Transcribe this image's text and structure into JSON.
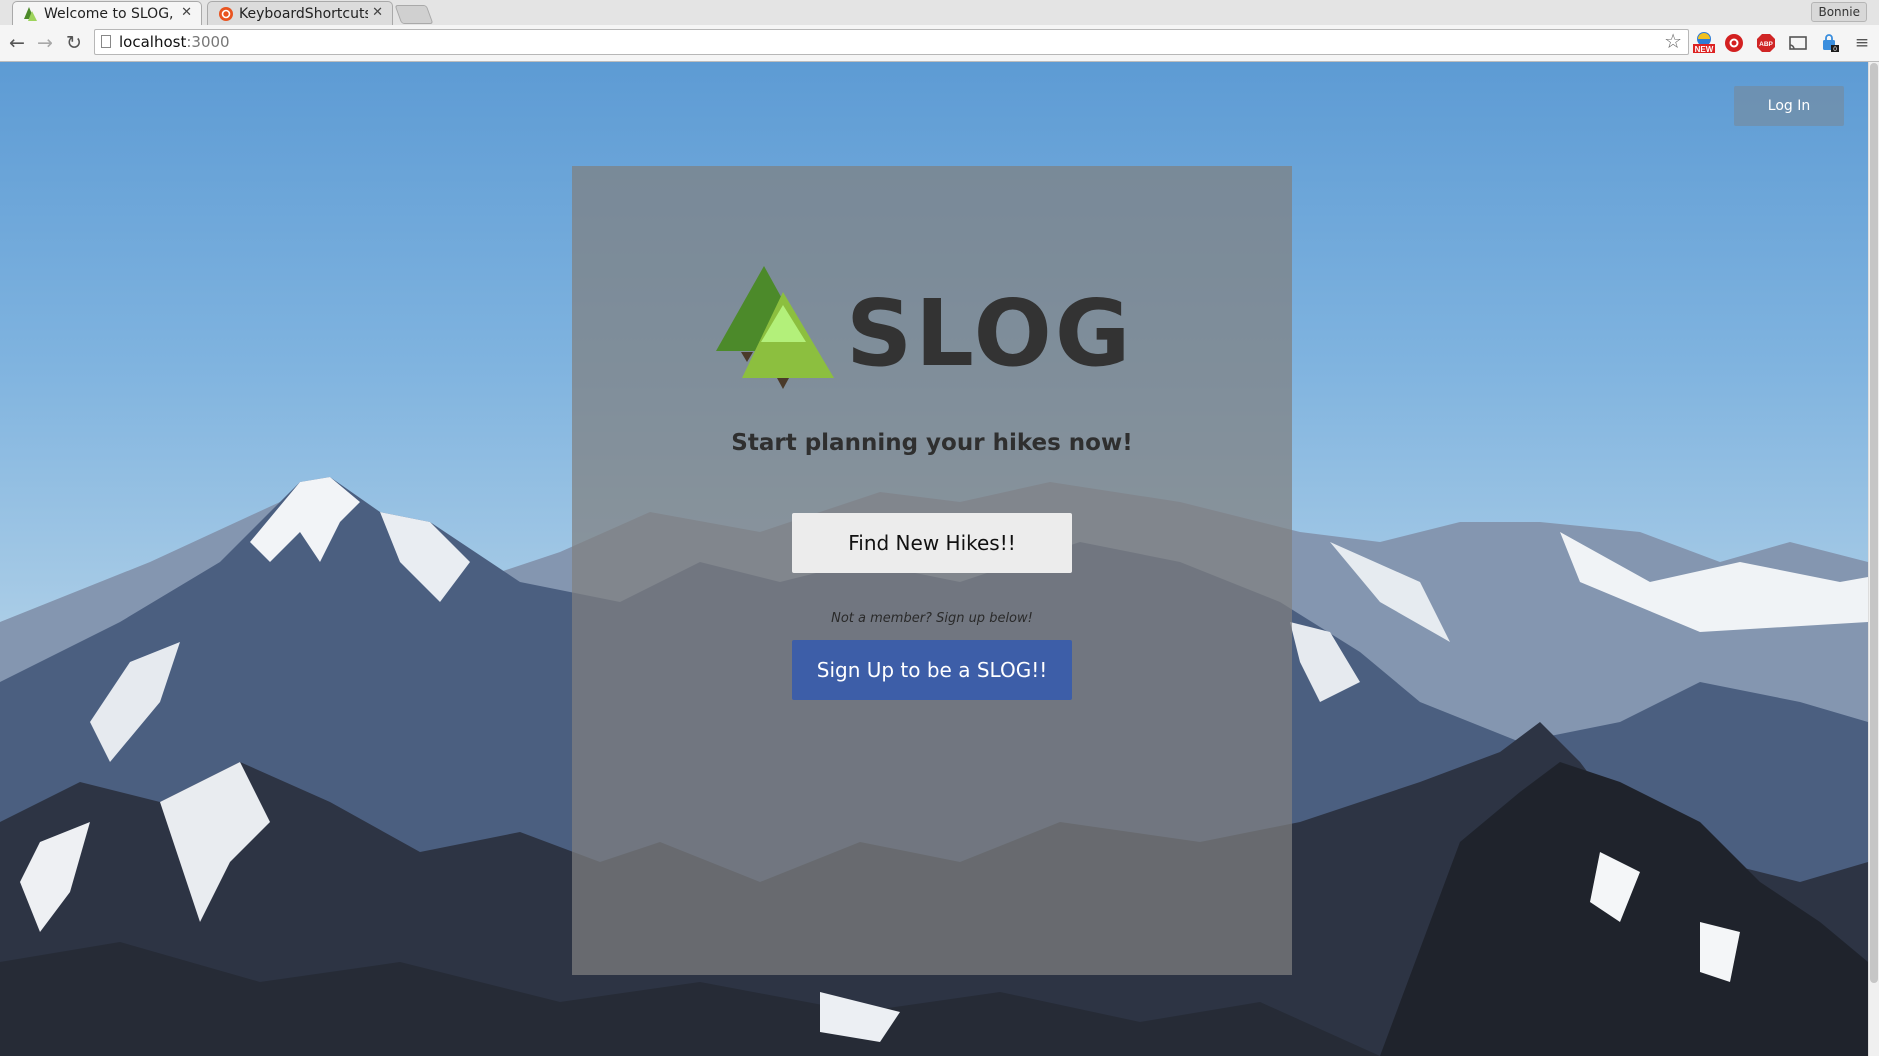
{
  "browser": {
    "tabs": [
      {
        "title": "Welcome to SLOG, lo",
        "active": true
      },
      {
        "title": "KeyboardShortcuts",
        "active": false
      }
    ],
    "profile_name": "Bonnie",
    "url_host": "localhost",
    "url_port": ":3000",
    "extensions": [
      "new-badge-extension-icon",
      "red-circle-extension-icon",
      "adblock-plus-icon",
      "cast-icon",
      "lastpass-icon"
    ],
    "extension_badge_new": "NEW",
    "extension_badge_count": "0"
  },
  "page": {
    "login_label": "Log In",
    "brand": "SLOG",
    "tagline": "Start planning your hikes now!",
    "find_hikes_label": "Find New Hikes!!",
    "member_note": "Not a member? Sign up below!",
    "signup_label": "Sign Up to be a SLOG!!"
  },
  "colors": {
    "signup_button": "#3d5ea8",
    "logo_dark_green": "#4c8a2a",
    "logo_light_green": "#b3f07a",
    "logo_mid_green": "#8cbf3f",
    "brand_text": "#333333"
  }
}
